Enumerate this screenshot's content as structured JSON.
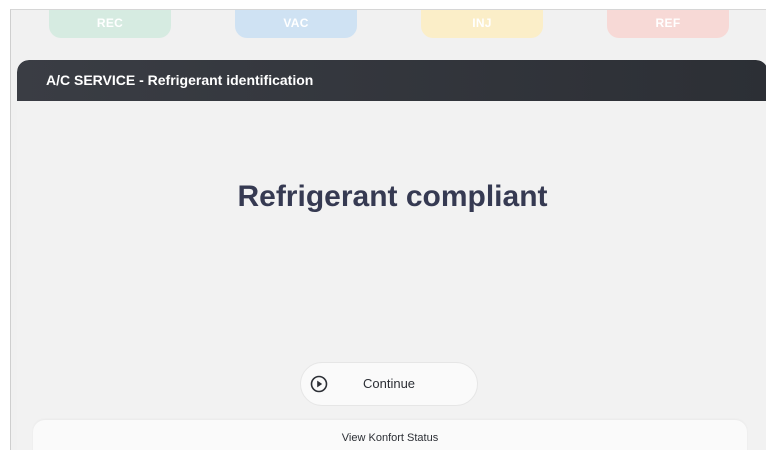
{
  "phase_tabs": {
    "rec": "REC",
    "vac": "VAC",
    "inj": "INJ",
    "ref": "REF"
  },
  "panel": {
    "title": "A/C SERVICE - Refrigerant identification",
    "message": "Refrigerant compliant"
  },
  "actions": {
    "continue_label": "Continue",
    "continue_icon": "play-circle-icon"
  },
  "footer": {
    "status_label": "View Konfort Status"
  },
  "colors": {
    "rec": "#d6ebe1",
    "vac": "#cfe2f3",
    "inj": "#fbeec8",
    "ref": "#f7d9d6",
    "header": "#2c2f35",
    "message": "#363a52"
  }
}
